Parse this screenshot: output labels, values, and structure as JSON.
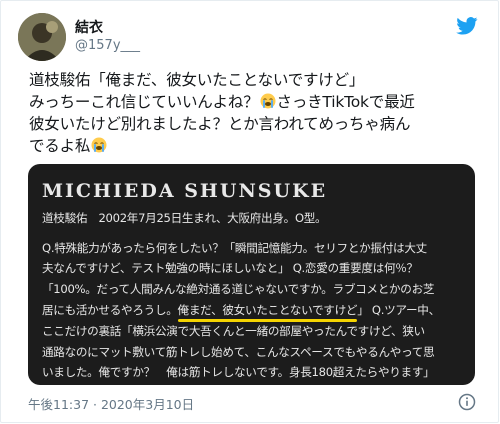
{
  "tweet": {
    "author_name": "結衣",
    "handle": "@157y___",
    "text_line1": "道枝駿佑「俺まだ、彼女いたことないですけど」",
    "text_line2a": "みっちーこれ信じていいんよね？",
    "text_line2b": "さっきTikTokで最近",
    "text_line3": "彼女いたけど別れましたよ？とか言われてめっちゃ病ん",
    "text_line4": "でるよ私",
    "timestamp": "午後11:37 · 2020年3月10日",
    "emoji": "loudly-crying-face"
  },
  "media": {
    "title": "MICHIEDA SHUNSUKE",
    "profile": "道枝駿佑　2002年7月25日生まれ、大阪府出身。O型。",
    "lines": [
      "Q.特殊能力があったら何をしたい？「瞬間記憶能力。セリフとか振付は大丈",
      "夫なんですけど、テスト勉強の時にほしいなと」 Q.恋愛の重要度は何％？",
      "「100%。だって人間みんな絶対通る道じゃないですか。ラブコメとかのお芝",
      "居にも活かせるやろうし。",
      "俺まだ、彼女いたことないですけど",
      "」 Q.ツアー中、",
      "ここだけの裏話「横浜公演で大吾くんと一緒の部屋やったんですけど、狭い",
      "通路なのにマット敷いて筋トレし始めて、こんなスペースでもやるんやって思",
      "いました。俺ですか？　俺は筋トレしないです。身長180超えたらやります」"
    ],
    "highlight_color": "#f5d400"
  },
  "colors": {
    "twitter_blue": "#1da1f2",
    "secondary_text": "#657786",
    "primary_text": "#14171a"
  }
}
